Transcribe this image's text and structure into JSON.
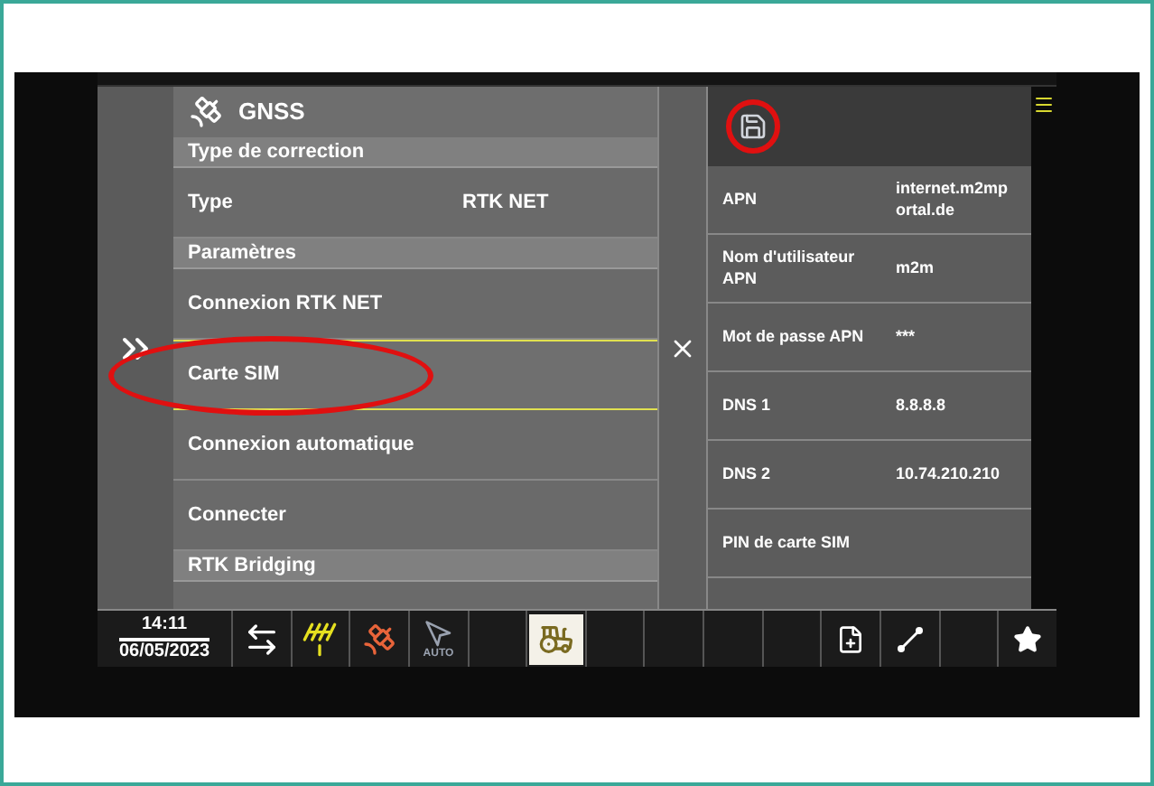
{
  "panel": {
    "title": "GNSS",
    "rows": [
      {
        "kind": "header",
        "label": "Type de correction",
        "selected": false
      },
      {
        "kind": "item",
        "label": "Type",
        "value": "RTK NET",
        "selected": false
      },
      {
        "kind": "header",
        "label": "Paramètres",
        "selected": false
      },
      {
        "kind": "item",
        "label": "Connexion RTK NET",
        "selected": false
      },
      {
        "kind": "item",
        "label": "Carte SIM",
        "selected": true
      },
      {
        "kind": "item",
        "label": "Connexion automatique",
        "selected": false
      },
      {
        "kind": "item",
        "label": "Connecter",
        "selected": false
      },
      {
        "kind": "header",
        "label": "RTK Bridging",
        "selected": false
      }
    ]
  },
  "details": {
    "rows": [
      {
        "label": "APN",
        "value": "internet.m2mportal.de"
      },
      {
        "label": "Nom d'utilisateur APN",
        "value": "m2m"
      },
      {
        "label": "Mot de passe APN",
        "value": "***"
      },
      {
        "label": "DNS 1",
        "value": "8.8.8.8"
      },
      {
        "label": "DNS 2",
        "value": "10.74.210.210"
      },
      {
        "label": "PIN de carte SIM"
      }
    ]
  },
  "taskbar": {
    "time": "14:11",
    "date": "06/05/2023",
    "buttons": [
      {
        "kind": "swap"
      },
      {
        "kind": "signal"
      },
      {
        "kind": "satellite"
      },
      {
        "kind": "auto",
        "label": "AUTO"
      },
      {
        "kind": "empty"
      },
      {
        "kind": "tractor"
      },
      {
        "kind": "empty"
      },
      {
        "kind": "empty"
      },
      {
        "kind": "empty"
      },
      {
        "kind": "empty"
      },
      {
        "kind": "file-add"
      },
      {
        "kind": "ab-line"
      },
      {
        "kind": "empty"
      },
      {
        "kind": "star"
      }
    ]
  }
}
